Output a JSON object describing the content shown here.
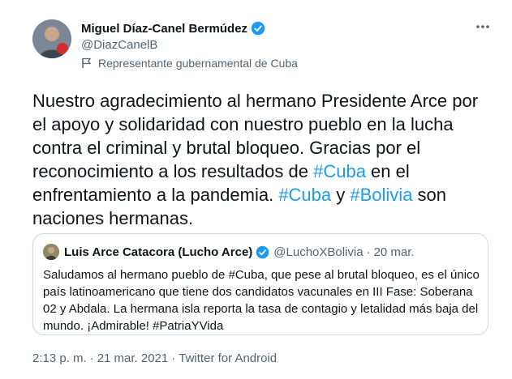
{
  "author": {
    "display_name": "Miguel Díaz-Canel Bermúdez",
    "handle": "@DiazCanelB",
    "label": "Representante gubernamental de Cuba"
  },
  "tweet": {
    "parts": [
      {
        "text": "Nuestro agradecimiento al hermano Presidente Arce por el apoyo y solidaridad con nuestro pueblo en la lucha contra el criminal y brutal bloqueo. Gracias por el reconocimiento a los resultados de ",
        "type": "text"
      },
      {
        "text": "#Cuba",
        "type": "hashtag"
      },
      {
        "text": " en el enfrentamiento a la pandemia. ",
        "type": "text"
      },
      {
        "text": "#Cuba",
        "type": "hashtag"
      },
      {
        "text": " y ",
        "type": "text"
      },
      {
        "text": "#Bolivia",
        "type": "hashtag"
      },
      {
        "text": " son naciones hermanas.",
        "type": "text"
      }
    ]
  },
  "quote": {
    "display_name": "Luis Arce Catacora (Lucho Arce)",
    "handle": "@LuchoXBolivia",
    "separator": "·",
    "date": "20 mar.",
    "body": "Saludamos al hermano pueblo de #Cuba, que pese al brutal bloqueo, es el único país latinoamericano que tiene dos candidatos vacunales en III Fase:  Soberana 02 y Abdala. La hermana isla reporta la tasa de contagio y letalidad más baja del mundo. ¡Admirable! #PatriaYVida"
  },
  "meta": {
    "time": "2:13 p. m.",
    "separator1": "·",
    "date": "21 mar. 2021",
    "separator2": "·",
    "source": "Twitter for Android"
  },
  "colors": {
    "accent": "#1d9bf0",
    "secondary_text": "#536471",
    "border": "#cfd9de"
  }
}
